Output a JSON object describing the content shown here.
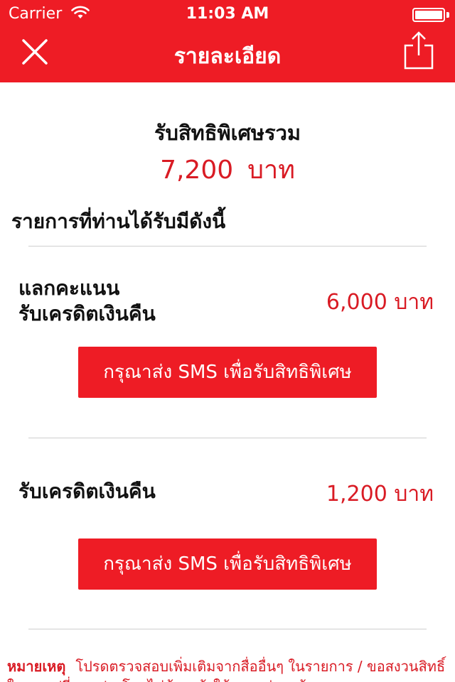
{
  "status_bar": {
    "carrier": "Carrier",
    "time": "11:03 AM"
  },
  "nav": {
    "title": "รายละเอียด",
    "close_icon": "close-icon",
    "share_icon": "share-icon"
  },
  "summary": {
    "title": "รับสิทธิพิเศษรวม",
    "amount": "7,200",
    "currency": "บาท"
  },
  "list_heading": "รายการที่ท่านได้รับมีดังนี้",
  "items": [
    {
      "label_line1": "แลกคะแนน",
      "label_line2": "รับเครดิตเงินคืน",
      "amount": "6,000 บาท",
      "button_label": "กรุณาส่ง SMS เพื่อรับสิทธิพิเศษ"
    },
    {
      "label_line1": "รับเครดิตเงินคืน",
      "amount": "1,200 บาท",
      "button_label": "กรุณาส่ง SMS เพื่อรับสิทธิพิเศษ"
    }
  ],
  "note": {
    "label": "หมายเหตุ",
    "text": "โปรดตรวจสอบเพิ่มเติมจากสื่ออื่นๆ ในรายการ / ขอสงวนสิทธิ์ในการเปลี่ยนแปลงโดยไม่ต้องแจ้งให้ทราบล่วงหน้า"
  },
  "colors": {
    "brand_red": "#ee1c25",
    "amount_red": "#d91b24"
  }
}
